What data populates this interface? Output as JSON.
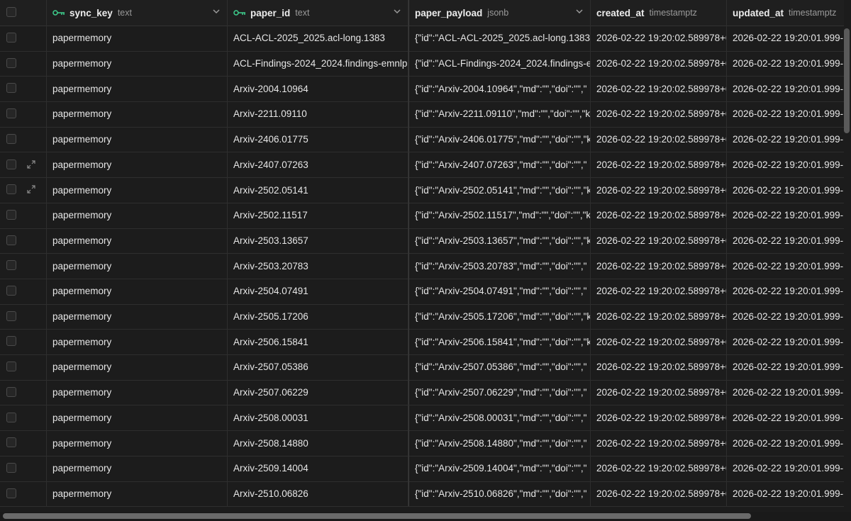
{
  "columns": [
    {
      "name": "sync_key",
      "type": "text",
      "is_primary_key": true
    },
    {
      "name": "paper_id",
      "type": "text",
      "is_primary_key": true
    },
    {
      "name": "paper_payload",
      "type": "jsonb",
      "is_primary_key": false
    },
    {
      "name": "created_at",
      "type": "timestamptz",
      "is_primary_key": false
    },
    {
      "name": "updated_at",
      "type": "timestamptz",
      "is_primary_key": false
    }
  ],
  "rows": [
    {
      "sync_key": "papermemory",
      "paper_id": "ACL-ACL-2025_2025.acl-long.1383",
      "paper_payload": "{\"id\":\"ACL-ACL-2025_2025.acl-long.1383\"",
      "created_at": "2026-02-22 19:20:02.589978+0",
      "updated_at": "2026-02-22 19:20:01.999-"
    },
    {
      "sync_key": "papermemory",
      "paper_id": "ACL-Findings-2024_2024.findings-emnlp",
      "paper_payload": "{\"id\":\"ACL-Findings-2024_2024.findings-e",
      "created_at": "2026-02-22 19:20:02.589978+0",
      "updated_at": "2026-02-22 19:20:01.999-"
    },
    {
      "sync_key": "papermemory",
      "paper_id": "Arxiv-2004.10964",
      "paper_payload": "{\"id\":\"Arxiv-2004.10964\",\"md\":\"\",\"doi\":\"\",\"",
      "created_at": "2026-02-22 19:20:02.589978+0",
      "updated_at": "2026-02-22 19:20:01.999-"
    },
    {
      "sync_key": "papermemory",
      "paper_id": "Arxiv-2211.09110",
      "paper_payload": "{\"id\":\"Arxiv-2211.09110\",\"md\":\"\",\"doi\":\"\",\"ke",
      "created_at": "2026-02-22 19:20:02.589978+0",
      "updated_at": "2026-02-22 19:20:01.999-"
    },
    {
      "sync_key": "papermemory",
      "paper_id": "Arxiv-2406.01775",
      "paper_payload": "{\"id\":\"Arxiv-2406.01775\",\"md\":\"\",\"doi\":\"\",\"k",
      "created_at": "2026-02-22 19:20:02.589978+0",
      "updated_at": "2026-02-22 19:20:01.999-"
    },
    {
      "sync_key": "papermemory",
      "paper_id": "Arxiv-2407.07263",
      "paper_payload": "{\"id\":\"Arxiv-2407.07263\",\"md\":\"\",\"doi\":\"\",\"",
      "created_at": "2026-02-22 19:20:02.589978+0",
      "updated_at": "2026-02-22 19:20:01.999-"
    },
    {
      "sync_key": "papermemory",
      "paper_id": "Arxiv-2502.05141",
      "paper_payload": "{\"id\":\"Arxiv-2502.05141\",\"md\":\"\",\"doi\":\"\",\"k",
      "created_at": "2026-02-22 19:20:02.589978+0",
      "updated_at": "2026-02-22 19:20:01.999-"
    },
    {
      "sync_key": "papermemory",
      "paper_id": "Arxiv-2502.11517",
      "paper_payload": "{\"id\":\"Arxiv-2502.11517\",\"md\":\"\",\"doi\":\"\",\"ke",
      "created_at": "2026-02-22 19:20:02.589978+0",
      "updated_at": "2026-02-22 19:20:01.999-"
    },
    {
      "sync_key": "papermemory",
      "paper_id": "Arxiv-2503.13657",
      "paper_payload": "{\"id\":\"Arxiv-2503.13657\",\"md\":\"\",\"doi\":\"\",\"k",
      "created_at": "2026-02-22 19:20:02.589978+0",
      "updated_at": "2026-02-22 19:20:01.999-"
    },
    {
      "sync_key": "papermemory",
      "paper_id": "Arxiv-2503.20783",
      "paper_payload": "{\"id\":\"Arxiv-2503.20783\",\"md\":\"\",\"doi\":\"\",\"",
      "created_at": "2026-02-22 19:20:02.589978+0",
      "updated_at": "2026-02-22 19:20:01.999-"
    },
    {
      "sync_key": "papermemory",
      "paper_id": "Arxiv-2504.07491",
      "paper_payload": "{\"id\":\"Arxiv-2504.07491\",\"md\":\"\",\"doi\":\"\",\"",
      "created_at": "2026-02-22 19:20:02.589978+0",
      "updated_at": "2026-02-22 19:20:01.999-"
    },
    {
      "sync_key": "papermemory",
      "paper_id": "Arxiv-2505.17206",
      "paper_payload": "{\"id\":\"Arxiv-2505.17206\",\"md\":\"\",\"doi\":\"\",\"k",
      "created_at": "2026-02-22 19:20:02.589978+0",
      "updated_at": "2026-02-22 19:20:01.999-"
    },
    {
      "sync_key": "papermemory",
      "paper_id": "Arxiv-2506.15841",
      "paper_payload": "{\"id\":\"Arxiv-2506.15841\",\"md\":\"\",\"doi\":\"\",\"k",
      "created_at": "2026-02-22 19:20:02.589978+0",
      "updated_at": "2026-02-22 19:20:01.999-"
    },
    {
      "sync_key": "papermemory",
      "paper_id": "Arxiv-2507.05386",
      "paper_payload": "{\"id\":\"Arxiv-2507.05386\",\"md\":\"\",\"doi\":\"\",\"",
      "created_at": "2026-02-22 19:20:02.589978+0",
      "updated_at": "2026-02-22 19:20:01.999-"
    },
    {
      "sync_key": "papermemory",
      "paper_id": "Arxiv-2507.06229",
      "paper_payload": "{\"id\":\"Arxiv-2507.06229\",\"md\":\"\",\"doi\":\"\",\"",
      "created_at": "2026-02-22 19:20:02.589978+0",
      "updated_at": "2026-02-22 19:20:01.999-"
    },
    {
      "sync_key": "papermemory",
      "paper_id": "Arxiv-2508.00031",
      "paper_payload": "{\"id\":\"Arxiv-2508.00031\",\"md\":\"\",\"doi\":\"\",\"",
      "created_at": "2026-02-22 19:20:02.589978+0",
      "updated_at": "2026-02-22 19:20:01.999-"
    },
    {
      "sync_key": "papermemory",
      "paper_id": "Arxiv-2508.14880",
      "paper_payload": "{\"id\":\"Arxiv-2508.14880\",\"md\":\"\",\"doi\":\"\",\"",
      "created_at": "2026-02-22 19:20:02.589978+0",
      "updated_at": "2026-02-22 19:20:01.999-"
    },
    {
      "sync_key": "papermemory",
      "paper_id": "Arxiv-2509.14004",
      "paper_payload": "{\"id\":\"Arxiv-2509.14004\",\"md\":\"\",\"doi\":\"\",\"",
      "created_at": "2026-02-22 19:20:02.589978+0",
      "updated_at": "2026-02-22 19:20:01.999-"
    },
    {
      "sync_key": "papermemory",
      "paper_id": "Arxiv-2510.06826",
      "paper_payload": "{\"id\":\"Arxiv-2510.06826\",\"md\":\"\",\"doi\":\"\",\"",
      "created_at": "2026-02-22 19:20:02.589978+0",
      "updated_at": "2026-02-22 19:20:01.999-"
    }
  ],
  "expand_icon_rows": [
    5,
    6
  ],
  "colors": {
    "background": "#1c1c1c",
    "border": "#2e2e2e",
    "primary_key_icon": "#3ecf8e",
    "muted_text": "#9a9a9a"
  }
}
